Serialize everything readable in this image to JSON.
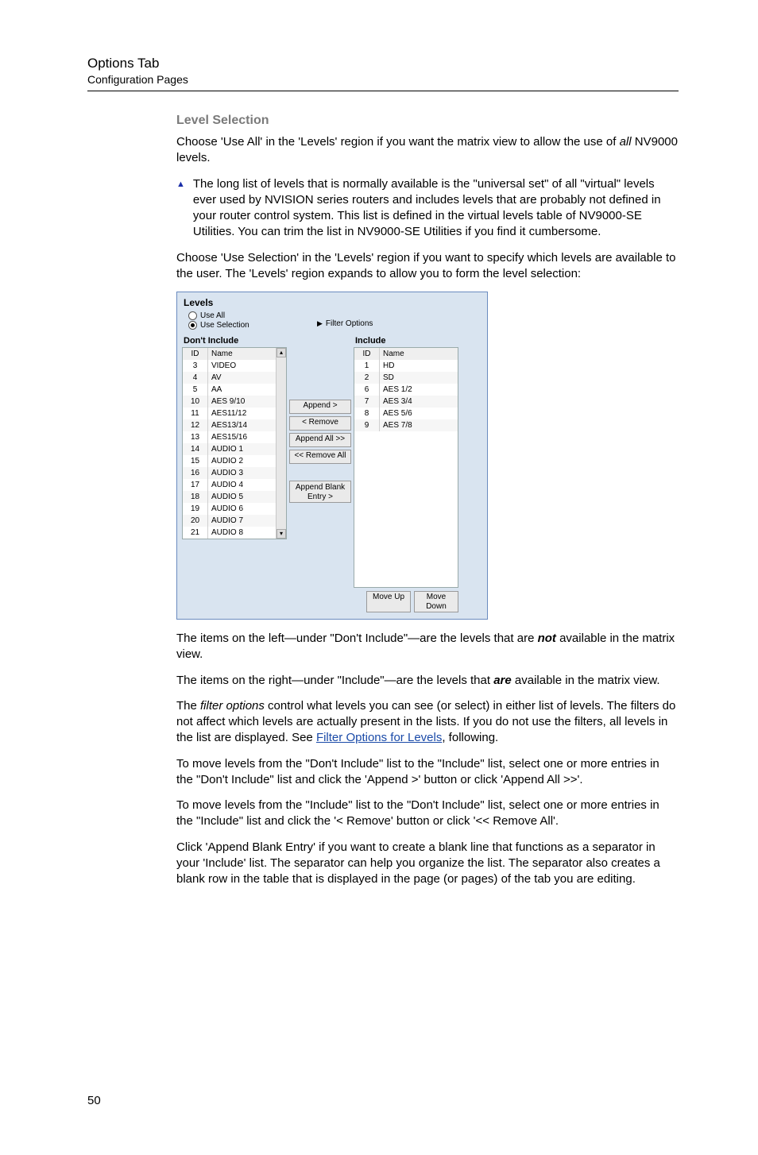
{
  "header": {
    "title": "Options Tab",
    "subtitle": "Configuration Pages"
  },
  "section_heading": "Level Selection",
  "p1a": "Choose 'Use All' in the 'Levels' region if you want the matrix view to allow the use of ",
  "p1b": "all",
  "p1c": " NV9000 levels.",
  "note1": "The long list of levels that is normally available is the \"universal set\" of all \"virtual\" levels ever used by NVISION series routers and includes levels that are probably not defined in your router control system. This list is defined in the virtual levels table of NV9000-SE Utilities. You can trim the list in NV9000-SE Utilities if you find it cumbersome.",
  "p2": "Choose 'Use Selection' in the 'Levels' region if you want to specify which levels are available to the user. The 'Levels' region expands to allow you to form the level selection:",
  "panel": {
    "title": "Levels",
    "radio_all": "Use All",
    "radio_sel": "Use Selection",
    "filter": "Filter Options",
    "dont_include": "Don't Include",
    "include": "Include",
    "col_id": "ID",
    "col_name": "Name",
    "left_rows": [
      {
        "id": "3",
        "name": "VIDEO"
      },
      {
        "id": "4",
        "name": "AV"
      },
      {
        "id": "5",
        "name": "AA"
      },
      {
        "id": "10",
        "name": "AES 9/10"
      },
      {
        "id": "11",
        "name": "AES11/12"
      },
      {
        "id": "12",
        "name": "AES13/14"
      },
      {
        "id": "13",
        "name": "AES15/16"
      },
      {
        "id": "14",
        "name": "AUDIO 1"
      },
      {
        "id": "15",
        "name": "AUDIO 2"
      },
      {
        "id": "16",
        "name": "AUDIO 3"
      },
      {
        "id": "17",
        "name": "AUDIO 4"
      },
      {
        "id": "18",
        "name": "AUDIO 5"
      },
      {
        "id": "19",
        "name": "AUDIO 6"
      },
      {
        "id": "20",
        "name": "AUDIO 7"
      },
      {
        "id": "21",
        "name": "AUDIO 8"
      }
    ],
    "right_rows": [
      {
        "id": "1",
        "name": "HD"
      },
      {
        "id": "2",
        "name": "SD"
      },
      {
        "id": "6",
        "name": "AES 1/2"
      },
      {
        "id": "7",
        "name": "AES 3/4"
      },
      {
        "id": "8",
        "name": "AES 5/6"
      },
      {
        "id": "9",
        "name": "AES 7/8"
      }
    ],
    "btn_append": "Append >",
    "btn_remove": "< Remove",
    "btn_append_all": "Append All >>",
    "btn_remove_all": "<< Remove All",
    "btn_blank": "Append Blank Entry >",
    "btn_up": "Move Up",
    "btn_down": "Move Down"
  },
  "p3a": "The items on the left—under \"Don't Include\"—are the levels that are ",
  "p3b": "not",
  "p3c": " available in the matrix view.",
  "p4a": "The items on the right—under \"Include\"—are the levels that ",
  "p4b": "are",
  "p4c": " available in the matrix view.",
  "p5a": "The ",
  "p5b": "filter options",
  "p5c": " control what levels you can see (or select) in either list of levels. The filters do not affect which levels are actually present in the lists. If you do not use the filters, all levels in the list are displayed. See ",
  "p5link": "Filter Options for Levels",
  "p5d": ", following.",
  "p6": "To move levels from the \"Don't Include\" list to the \"Include\" list, select one or more entries in the \"Don't Include\" list and click the 'Append >' button or click 'Append All >>'.",
  "p7": "To move levels from the \"Include\" list to the \"Don't Include\" list, select one or more entries in the \"Include\" list and click the '< Remove' button or click '<< Remove All'.",
  "p8": "Click 'Append Blank Entry' if you want to create a blank line that functions as a separator in your 'Include' list. The separator can help you organize the list. The separator also creates a blank row in the table that is displayed in the page (or pages) of the tab you are editing.",
  "page_number": "50"
}
